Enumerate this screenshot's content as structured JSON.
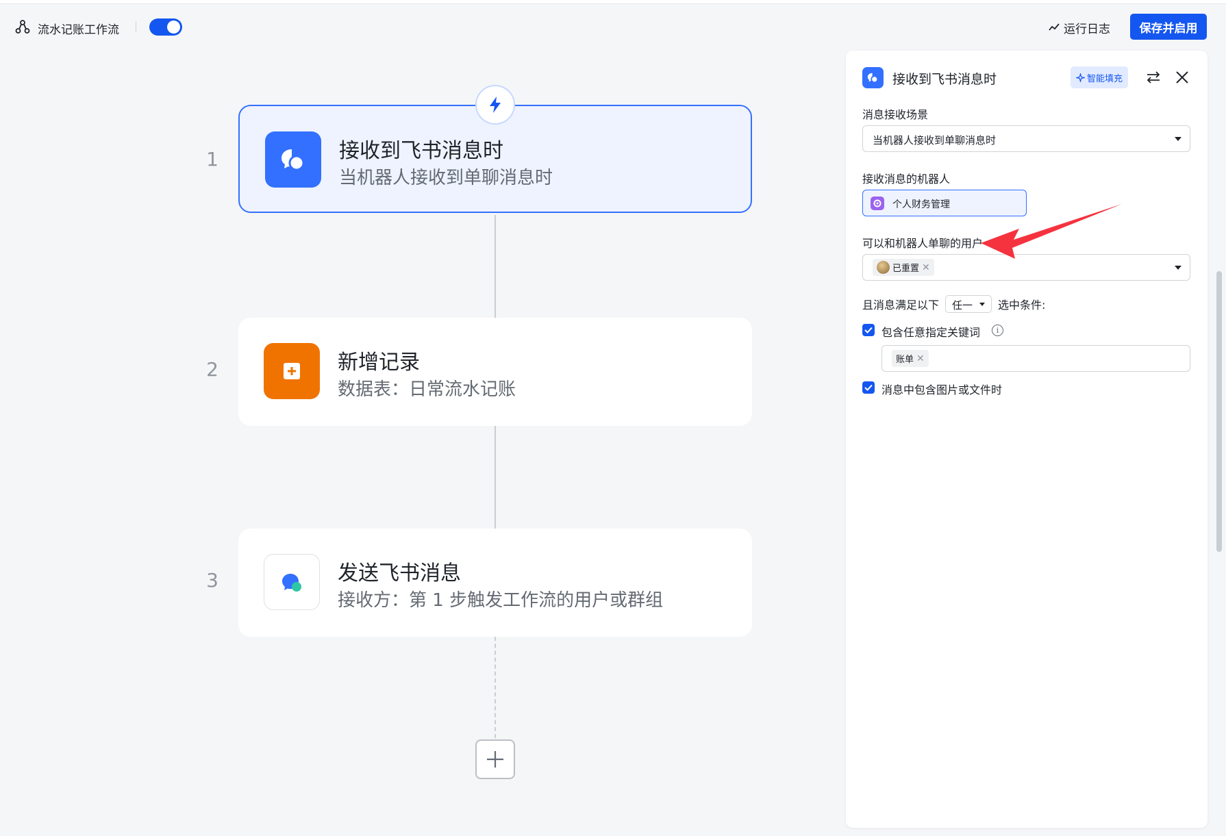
{
  "header": {
    "workflow_name": "流水记账工作流",
    "enabled": true,
    "run_log": "运行日志",
    "save_enable": "保存并启用"
  },
  "steps": [
    {
      "number": "1",
      "title": "接收到飞书消息时",
      "subtitle": "当机器人接收到单聊消息时",
      "icon": "feishu-message-trigger-icon",
      "color": "#3370ff"
    },
    {
      "number": "2",
      "title": "新增记录",
      "subtitle": "数据表：日常流水记账",
      "icon": "add-record-icon",
      "color": "#f07300"
    },
    {
      "number": "3",
      "title": "发送飞书消息",
      "subtitle": "接收方：第 1 步触发工作流的用户或群组",
      "icon": "send-message-icon",
      "color": "#ffffff"
    }
  ],
  "panel": {
    "title": "接收到飞书消息时",
    "smart_fill": "智能填充",
    "scene_label": "消息接收场景",
    "scene_value": "当机器人接收到单聊消息时",
    "bot_label": "接收消息的机器人",
    "bot_name": "个人财务管理",
    "users_label": "可以和机器人单聊的用户",
    "user_chip": "已重置",
    "condition_prefix": "且消息满足以下",
    "condition_mode": "任一",
    "condition_suffix": "选中条件:",
    "keyword_label": "包含任意指定关键词",
    "keyword_chip": "账单",
    "keyword_checked": true,
    "file_label": "消息中包含图片或文件时",
    "file_checked": true
  },
  "colors": {
    "accent": "#1456f0",
    "annotation_arrow": "#f5333f"
  }
}
